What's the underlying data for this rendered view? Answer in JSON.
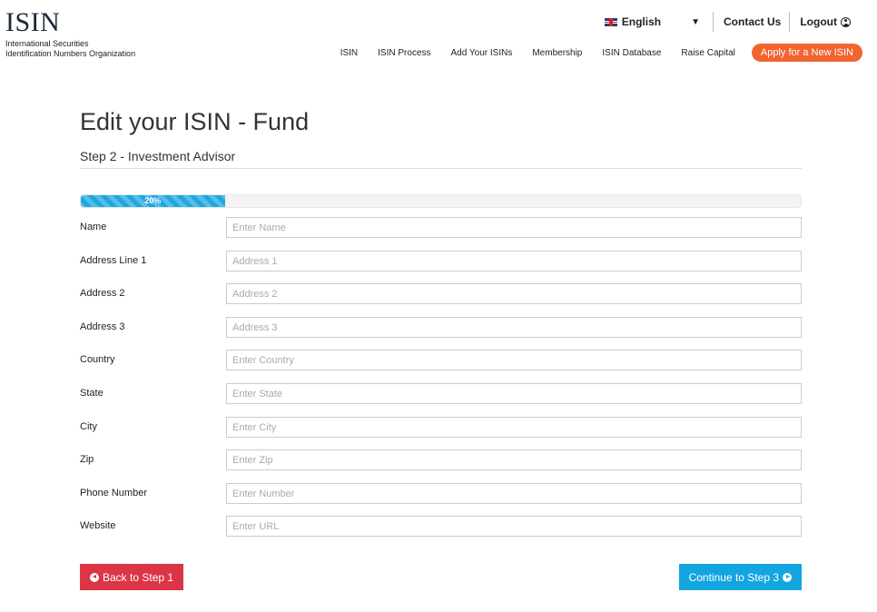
{
  "brand": {
    "logo_text": "ISIN",
    "subtitle_line1": "International Securities",
    "subtitle_line2": "Identification Numbers Organization"
  },
  "topbar": {
    "language": "English",
    "contact": "Contact Us",
    "logout": "Logout"
  },
  "nav": {
    "items": [
      "ISIN",
      "ISIN Process",
      "Add Your ISINs",
      "Membership",
      "ISIN Database",
      "Raise Capital"
    ],
    "apply": "Apply for a New ISIN"
  },
  "page": {
    "title": "Edit your ISIN - Fund",
    "step": "Step 2 - Investment Advisor",
    "progress_label": "20%",
    "progress_value": 0.2
  },
  "form": {
    "fields": [
      {
        "label": "Name",
        "placeholder": "Enter Name",
        "value": ""
      },
      {
        "label": "Address Line 1",
        "placeholder": "Address 1",
        "value": ""
      },
      {
        "label": "Address 2",
        "placeholder": "Address 2",
        "value": ""
      },
      {
        "label": "Address 3",
        "placeholder": "Address 3",
        "value": ""
      },
      {
        "label": "Country",
        "placeholder": "Enter Country",
        "value": ""
      },
      {
        "label": "State",
        "placeholder": "Enter State",
        "value": ""
      },
      {
        "label": "City",
        "placeholder": "Enter City",
        "value": ""
      },
      {
        "label": "Zip",
        "placeholder": "Enter Zip",
        "value": ""
      },
      {
        "label": "Phone Number",
        "placeholder": "Enter Number",
        "value": ""
      },
      {
        "label": "Website",
        "placeholder": "Enter URL",
        "value": ""
      }
    ]
  },
  "buttons": {
    "back": "Back to Step 1",
    "next": "Continue to Step 3"
  },
  "colors": {
    "accent": "#12a6e0",
    "danger": "#dc3545",
    "apply": "#f26430"
  }
}
